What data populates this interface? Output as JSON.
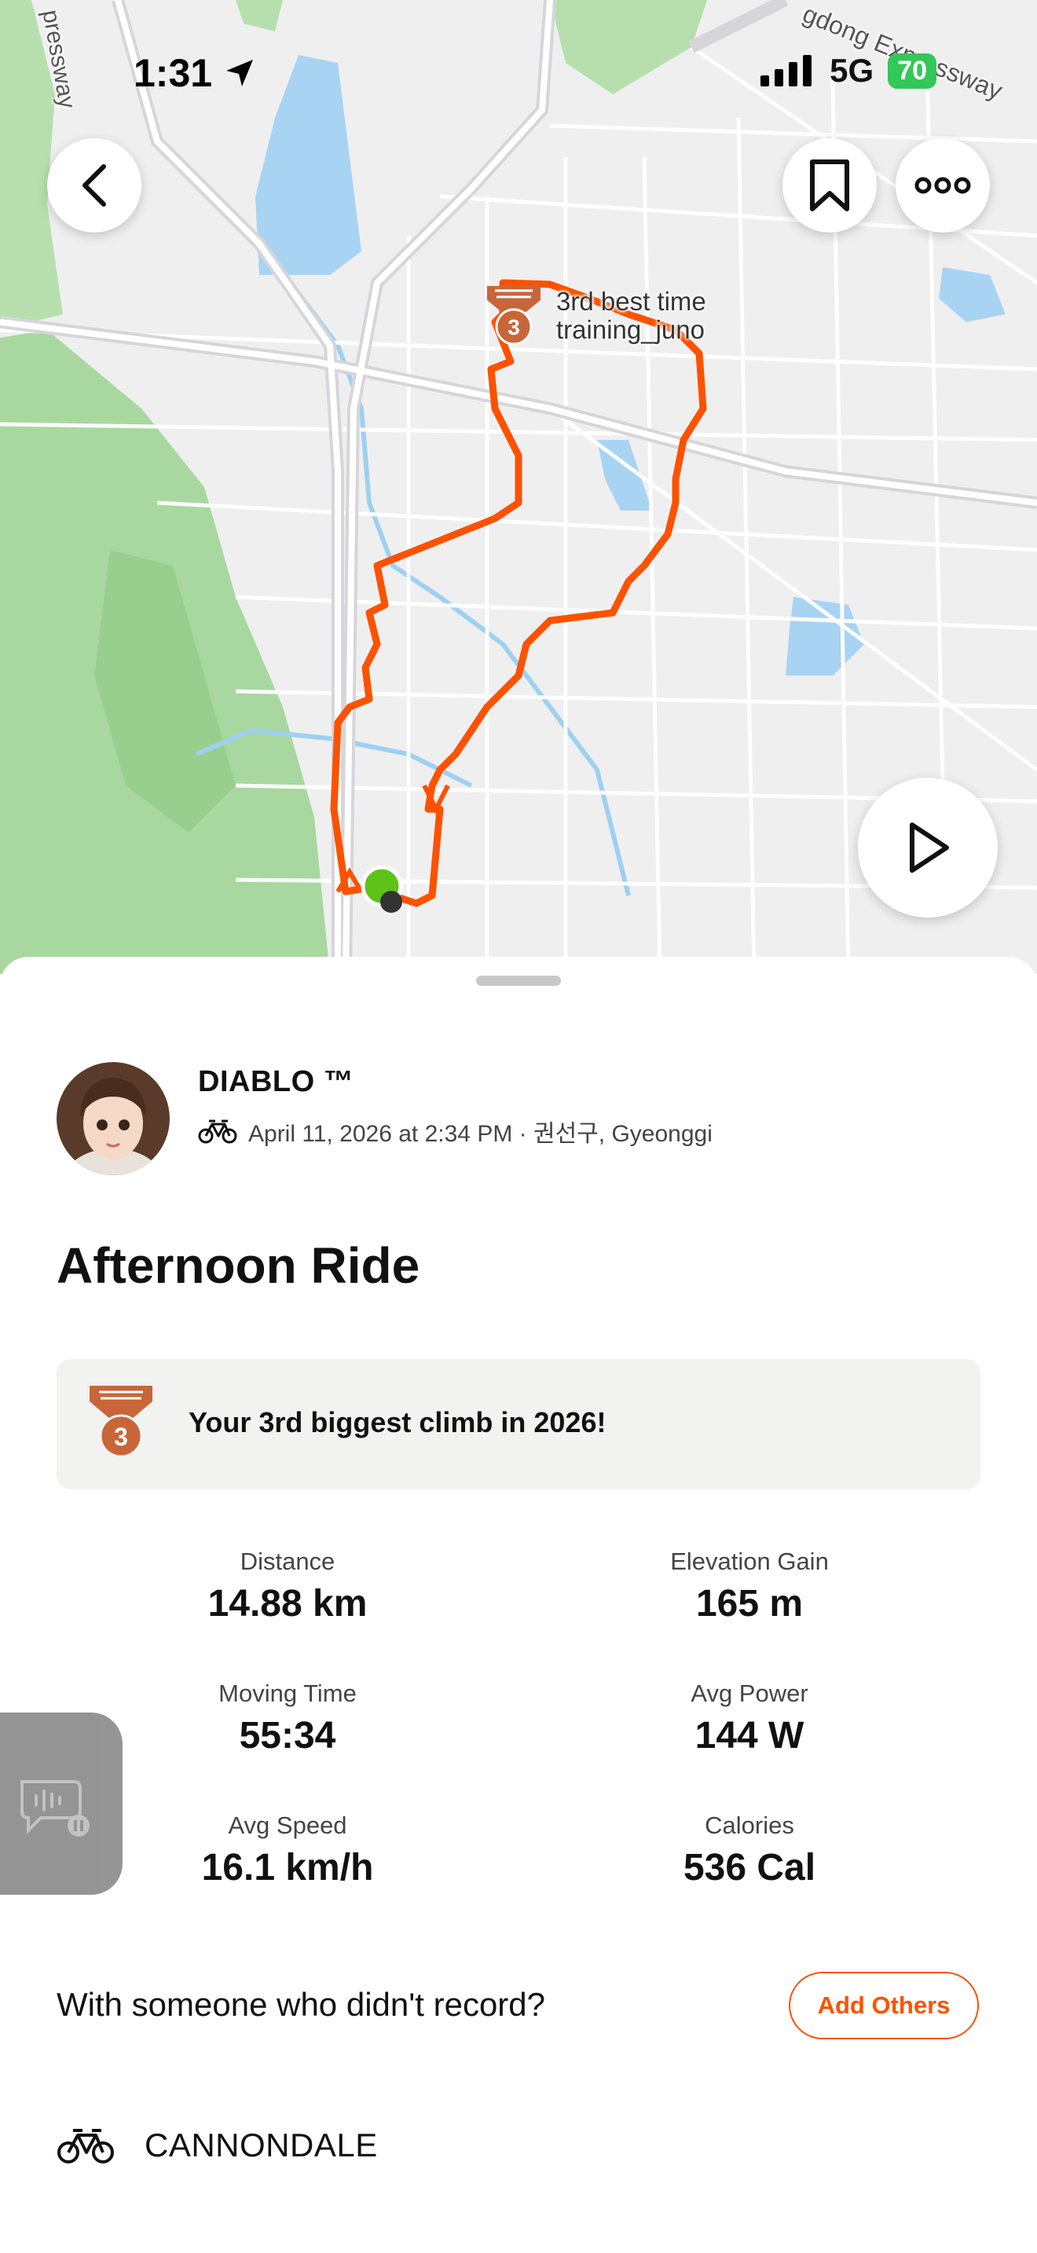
{
  "status_bar": {
    "time": "1:31",
    "network": "5G",
    "battery": "70"
  },
  "map": {
    "labels": {
      "road_top_left": "pressway",
      "road_top_right": "gdong Expressway",
      "segment_line1": "3rd best time",
      "segment_line2": "training_juno"
    },
    "medal_rank": "3"
  },
  "activity": {
    "athlete_name": "DIABLO ™",
    "date_location": "April 11, 2026 at 2:34 PM · 권선구, Gyeonggi",
    "title": "Afternoon Ride",
    "achievement": {
      "rank": "3",
      "text": "Your 3rd biggest climb in 2026!"
    }
  },
  "stats": [
    {
      "label": "Distance",
      "value": "14.88 km"
    },
    {
      "label": "Elevation Gain",
      "value": "165 m"
    },
    {
      "label": "Moving Time",
      "value": "55:34"
    },
    {
      "label": "Avg Power",
      "value": "144 W"
    },
    {
      "label": "Avg Speed",
      "value": "16.1 km/h"
    },
    {
      "label": "Calories",
      "value": "536 Cal"
    }
  ],
  "with_others": {
    "prompt": "With someone who didn't record?",
    "button": "Add Others"
  },
  "gear": {
    "name": "CANNONDALE"
  },
  "colors": {
    "accent": "#fc5200",
    "route": "#fc5200",
    "medal": "#c8663a",
    "park": "#a8d8a0",
    "water": "#a9d3f3"
  },
  "icons": [
    "location-arrow-icon",
    "signal-icon",
    "chevron-left-icon",
    "bookmark-icon",
    "more-icon",
    "play-icon",
    "bike-icon",
    "medal-icon",
    "voice-note-icon"
  ]
}
